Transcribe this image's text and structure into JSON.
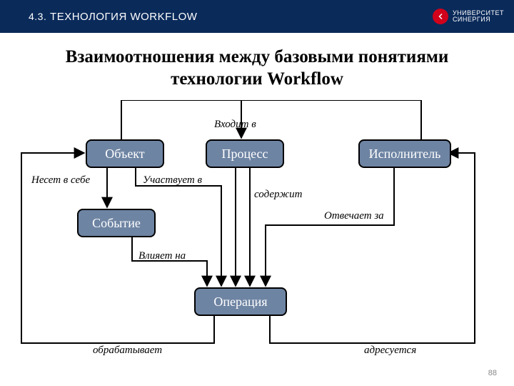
{
  "header": {
    "section_number": "4.3.",
    "section_title": "ТЕХНОЛОГИЯ WORKFLOW"
  },
  "logo": {
    "line1": "УНИВЕРСИТЕТ",
    "line2": "СИНЕРГИЯ"
  },
  "title": "Взаимоотношения между базовыми понятиями технологии Workflow",
  "nodes": {
    "object": "Объект",
    "process": "Процесс",
    "executor": "Исполнитель",
    "event": "Событие",
    "operation": "Операция"
  },
  "edges": {
    "enters": "Входит в",
    "carries": "Несет в себе",
    "participates": "Участвует в",
    "contains": "содержит",
    "responsible": "Отвечает за",
    "affects": "Влияет на",
    "processes": "обрабатывает",
    "addressed": "адресуется"
  },
  "page_number": "88"
}
